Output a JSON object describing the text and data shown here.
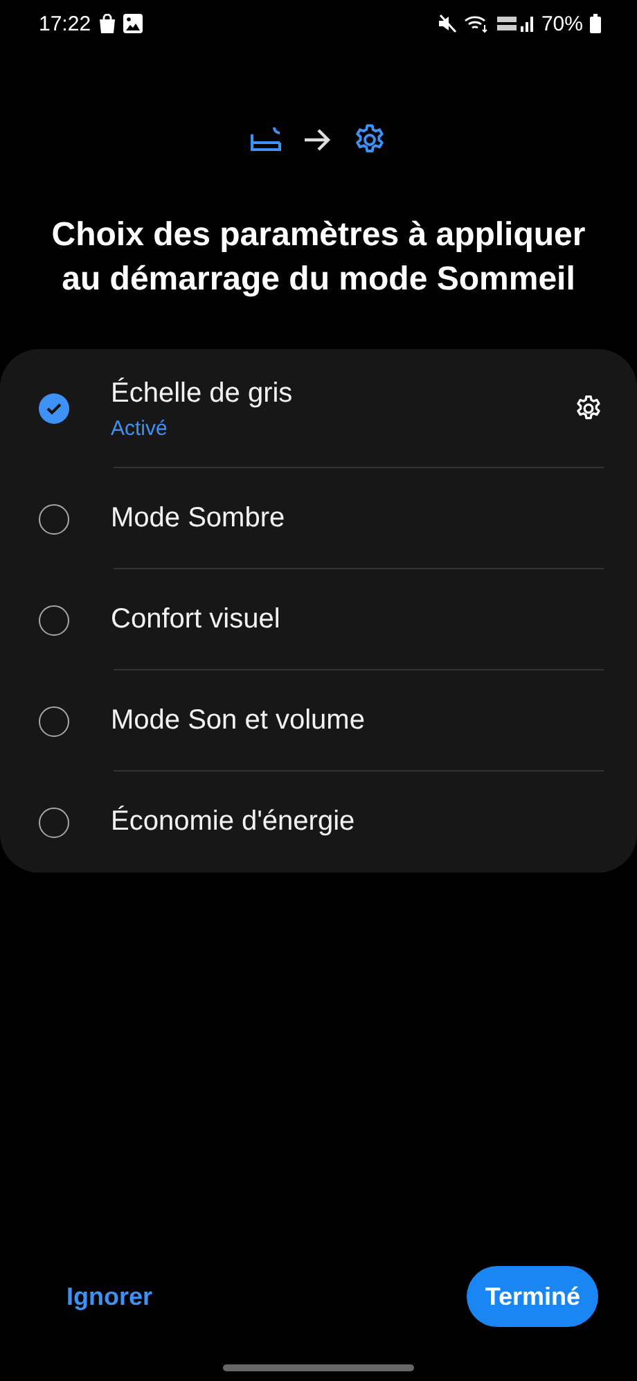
{
  "status_bar": {
    "time": "17:22",
    "battery": "70%"
  },
  "title": "Choix des paramètres à appliquer au démarrage du mode Sommeil",
  "options": [
    {
      "label": "Échelle de gris",
      "status": "Activé",
      "checked": true,
      "settings": true
    },
    {
      "label": "Mode Sombre",
      "checked": false,
      "settings": false
    },
    {
      "label": "Confort visuel",
      "checked": false,
      "settings": false
    },
    {
      "label": "Mode Son et volume",
      "checked": false,
      "settings": false
    },
    {
      "label": "Économie d'énergie",
      "checked": false,
      "settings": false
    }
  ],
  "buttons": {
    "skip": "Ignorer",
    "done": "Terminé"
  }
}
